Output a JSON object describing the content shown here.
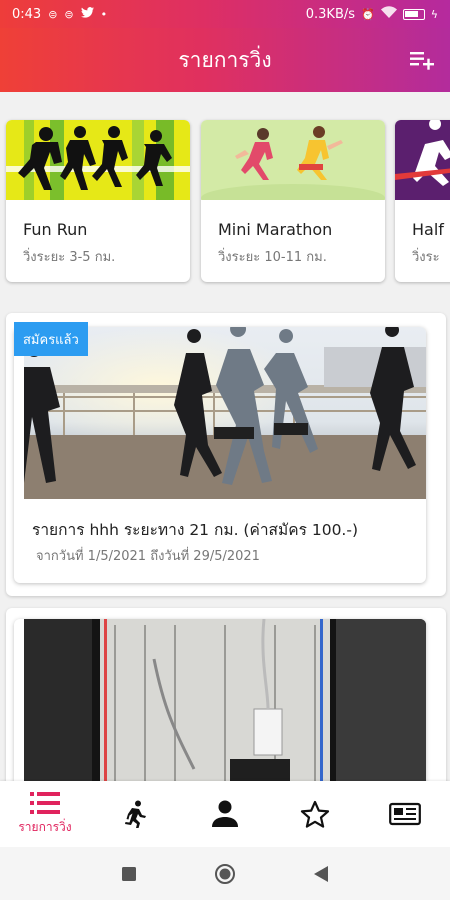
{
  "status_bar": {
    "time": "0:43",
    "network_speed": "0.3KB/s",
    "icons": [
      "notification-icon",
      "notification-icon",
      "twitter-icon",
      "dot-icon",
      "alarm-icon",
      "wifi-icon",
      "battery-icon",
      "charging-icon"
    ]
  },
  "app_bar": {
    "title": "รายการวิ่ง",
    "action_icon": "playlist-add-icon"
  },
  "categories": [
    {
      "name": "Fun Run",
      "distance": "วิ่งระยะ 3-5 กม."
    },
    {
      "name": "Mini Marathon",
      "distance": "วิ่งระยะ 10-11 กม."
    },
    {
      "name": "Half",
      "distance": "วิ่งระ"
    }
  ],
  "events": [
    {
      "badge": "สมัครแล้ว",
      "title": "รายการ hhh ระยะทาง 21 กม. (ค่าสมัคร  100.-)",
      "date": "จากวันที่ 1/5/2021 ถึงวันที่ 29/5/2021"
    }
  ],
  "bottom_nav": {
    "items": [
      {
        "icon": "list-icon",
        "label": "รายการวิ่ง",
        "active": true
      },
      {
        "icon": "running-icon",
        "label": ""
      },
      {
        "icon": "person-icon",
        "label": ""
      },
      {
        "icon": "star-icon",
        "label": ""
      },
      {
        "icon": "newspaper-icon",
        "label": ""
      }
    ]
  },
  "colors": {
    "header_start": "#ef4037",
    "header_end": "#b32c9c",
    "accent": "#e0235d",
    "badge": "#2c9cf1"
  }
}
